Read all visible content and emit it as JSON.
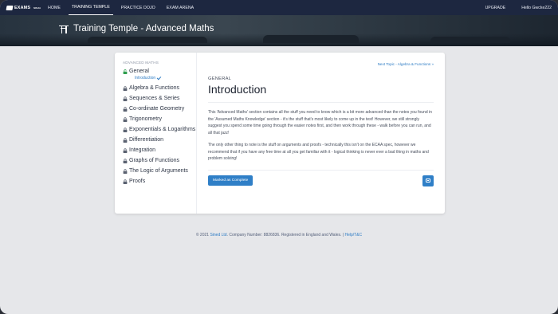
{
  "brand": {
    "name": "EXAMS",
    "sub": "NINJA"
  },
  "nav": {
    "links": [
      {
        "label": "HOME"
      },
      {
        "label": "TRAINING TEMPLE",
        "active": true
      },
      {
        "label": "PRACTICE DOJO"
      },
      {
        "label": "EXAM ARENA"
      }
    ],
    "upgrade": "UPGRADE",
    "user": "Hello Gwcke222"
  },
  "hero": {
    "title": "Training Temple - Advanced Maths"
  },
  "sidebar": {
    "heading": "ADVANCED MATHS",
    "items": [
      {
        "label": "General",
        "status": "unlocked",
        "sub": "Introduction"
      },
      {
        "label": "Algebra & Functions",
        "status": "locked"
      },
      {
        "label": "Sequences & Series",
        "status": "locked"
      },
      {
        "label": "Co-ordinate Geometry",
        "status": "locked"
      },
      {
        "label": "Trigonometry",
        "status": "locked"
      },
      {
        "label": "Exponentials & Logarithms",
        "status": "locked"
      },
      {
        "label": "Differentiation",
        "status": "locked"
      },
      {
        "label": "Integration",
        "status": "locked"
      },
      {
        "label": "Graphs of Functions",
        "status": "locked"
      },
      {
        "label": "The Logic of Arguments",
        "status": "locked"
      },
      {
        "label": "Proofs",
        "status": "locked"
      }
    ]
  },
  "main": {
    "next_topic": "Next Topic - Algebra & Functions »",
    "kicker": "GENERAL",
    "title": "Introduction",
    "paragraphs": [
      "This 'Advanced Maths' section contains all the stuff you need to know which is a bit more advanced than the notes you found in the 'Assumed Maths Knowledge' section - it's the stuff that's most likely to come up in the test! However, we still strongly suggest you spend some time going through the easier notes first, and then work through these - walk before you can run, and all that jazz!",
      "The only other thing to note is the stuff on arguments and proofs - technically this isn't on the ECAA spec, however we recommend that if you have any free time at all you get familiar with it - logical thinking is never ever a bad thing in maths and problem solving!"
    ],
    "complete_button": "Marked as Complete"
  },
  "footer": {
    "text1": "© 2021 ",
    "company": "Sined Ltd",
    "text2": ". Company Number: 8826836. Registered in England and Wales. | ",
    "help": "Help/T&C"
  },
  "colors": {
    "nav_bg": "#1d2740",
    "accent": "#2f7fc7",
    "page_bg": "#e6e7ea",
    "unlocked": "#2e9e4e",
    "locked": "#5a6170"
  }
}
